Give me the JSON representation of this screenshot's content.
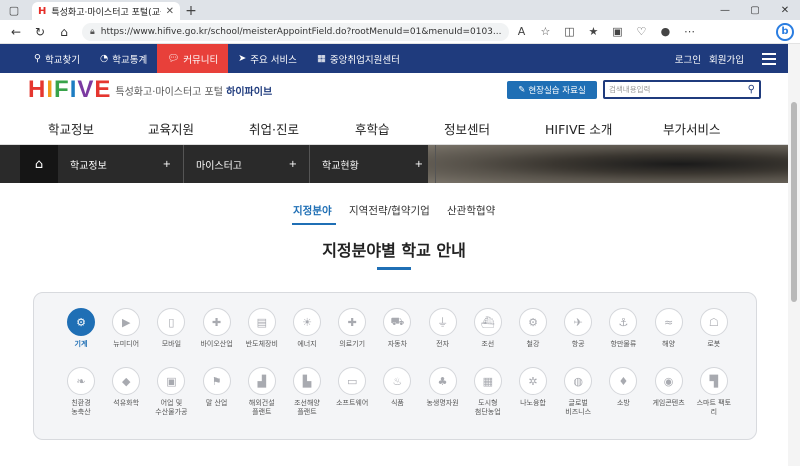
{
  "browser": {
    "tab_title": "특성화고·마이스터고 포털(교육부",
    "url": "https://www.hifive.go.kr/school/meisterAppointField.do?rootMenuId=01&menuId=0103..."
  },
  "topnav": {
    "items": [
      "학교찾기",
      "학교통계",
      "커뮤니티",
      "주요 서비스",
      "중앙취업지원센터"
    ],
    "login": "로그인",
    "join": "회원가입"
  },
  "brand": {
    "logo": [
      "H",
      "I",
      "F",
      "I",
      "V",
      "E"
    ],
    "slogan_prefix": "특성화고·마이스터고 포털",
    "slogan_name": "하이파이브",
    "practice_button": "현장실습 자료실",
    "search_placeholder": "검색내용입력"
  },
  "gnb": [
    "학교정보",
    "교육지원",
    "취업·진로",
    "후학습",
    "정보센터",
    "HIFIVE 소개",
    "부가서비스"
  ],
  "breadcrumb": [
    "학교정보",
    "마이스터고",
    "학교현황"
  ],
  "subtabs": [
    "지정분야",
    "지역전략/협약기업",
    "산관학협약"
  ],
  "heading": "지정분야별 학교 안내",
  "categories_row1": [
    {
      "label": "기계",
      "icon": "gear-icon",
      "glyph": "⚙",
      "active": true
    },
    {
      "label": "뉴미디어",
      "icon": "video-icon",
      "glyph": "▶"
    },
    {
      "label": "모바일",
      "icon": "mobile-icon",
      "glyph": "▯"
    },
    {
      "label": "바이오산업",
      "icon": "medkit-icon",
      "glyph": "✚"
    },
    {
      "label": "반도체장비",
      "icon": "chip-icon",
      "glyph": "▤"
    },
    {
      "label": "에너지",
      "icon": "bulb-icon",
      "glyph": "☀"
    },
    {
      "label": "의료기기",
      "icon": "medical-icon",
      "glyph": "✚"
    },
    {
      "label": "자동차",
      "icon": "car-icon",
      "glyph": "⛟"
    },
    {
      "label": "전자",
      "icon": "plug-icon",
      "glyph": "⏚"
    },
    {
      "label": "조선",
      "icon": "ship-icon",
      "glyph": "⛴"
    },
    {
      "label": "철강",
      "icon": "steel-icon",
      "glyph": "⚙"
    },
    {
      "label": "항공",
      "icon": "plane-icon",
      "glyph": "✈"
    },
    {
      "label": "항만물류",
      "icon": "anchor-icon",
      "glyph": "⚓"
    },
    {
      "label": "해양",
      "icon": "wave-icon",
      "glyph": "≈"
    },
    {
      "label": "로봇",
      "icon": "robot-icon",
      "glyph": "☖"
    }
  ],
  "categories_row2": [
    {
      "label": "친환경\n농축산",
      "icon": "leaf-icon",
      "glyph": "❧"
    },
    {
      "label": "석유화학",
      "icon": "drop-icon",
      "glyph": "◆"
    },
    {
      "label": "어업 및\n수산물가공",
      "icon": "train-icon",
      "glyph": "▣"
    },
    {
      "label": "말 산업",
      "icon": "flag-icon",
      "glyph": "⚑"
    },
    {
      "label": "해외건설\n플랜트",
      "icon": "factory-icon",
      "glyph": "▟"
    },
    {
      "label": "조선해양\n플랜트",
      "icon": "plant-icon",
      "glyph": "▙"
    },
    {
      "label": "소프트웨어",
      "icon": "laptop-icon",
      "glyph": "▭"
    },
    {
      "label": "식품",
      "icon": "food-icon",
      "glyph": "♨"
    },
    {
      "label": "농생명자원",
      "icon": "tree-icon",
      "glyph": "♣"
    },
    {
      "label": "도시형\n첨단농업",
      "icon": "building-icon",
      "glyph": "▦"
    },
    {
      "label": "나노융합",
      "icon": "nano-icon",
      "glyph": "✲"
    },
    {
      "label": "글로벌\n비즈니스",
      "icon": "globe-icon",
      "glyph": "◍"
    },
    {
      "label": "소방",
      "icon": "fire-icon",
      "glyph": "♦"
    },
    {
      "label": "게임콘텐츠",
      "icon": "gamepad-icon",
      "glyph": "◉"
    },
    {
      "label": "스마트 팩토\n리",
      "icon": "smart-factory-icon",
      "glyph": "▜"
    }
  ]
}
